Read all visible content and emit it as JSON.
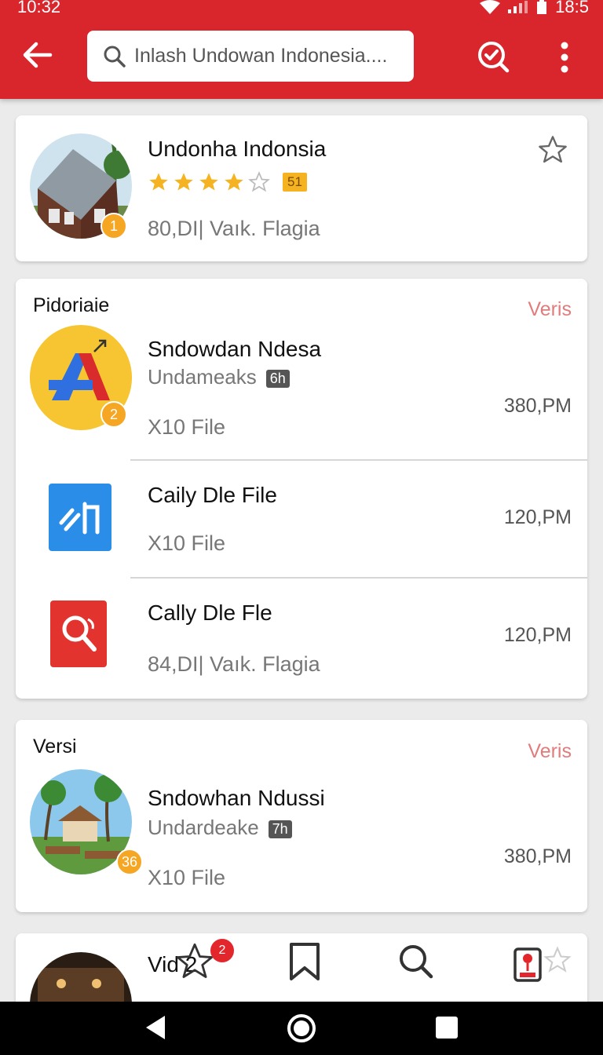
{
  "status_bar": {
    "time": "10:32",
    "clock_right": "18:5"
  },
  "header": {
    "search_text": "Inlash Undowan Indonesia...."
  },
  "featured": {
    "title": "Undonha Indonsia",
    "rating_stars": 4,
    "rating_chip": "51",
    "meta": "80,DI|  Vaık. Flagia",
    "avatar_badge": "1"
  },
  "section1": {
    "title": "Pidoriaie",
    "link": "Veris",
    "items": [
      {
        "title": "Sndowdan Ndesa",
        "sub": "Undameaks",
        "tag": "6h",
        "meta": "X10 File",
        "price": "380,PM",
        "badge": "2"
      },
      {
        "title": "Caily Dle File",
        "meta": "X10 File",
        "price": "120,PM"
      },
      {
        "title": "Cally Dle Fle",
        "meta": "84,DI|  Vaık. Flagia",
        "price": "120,PM"
      }
    ]
  },
  "section2": {
    "title": "Versi",
    "link": "Veris",
    "item": {
      "title": "Sndowhan Ndussi",
      "sub": "Undardeake",
      "tag": "7h",
      "meta": "X10 File",
      "price": "380,PM",
      "badge": "36"
    }
  },
  "partial_card": {
    "title": "Vid 2"
  },
  "bottom_nav": {
    "badge_count": "2"
  },
  "colors": {
    "primary": "#d8262c",
    "accent_star": "#f5b321",
    "link": "#e27c7c"
  }
}
